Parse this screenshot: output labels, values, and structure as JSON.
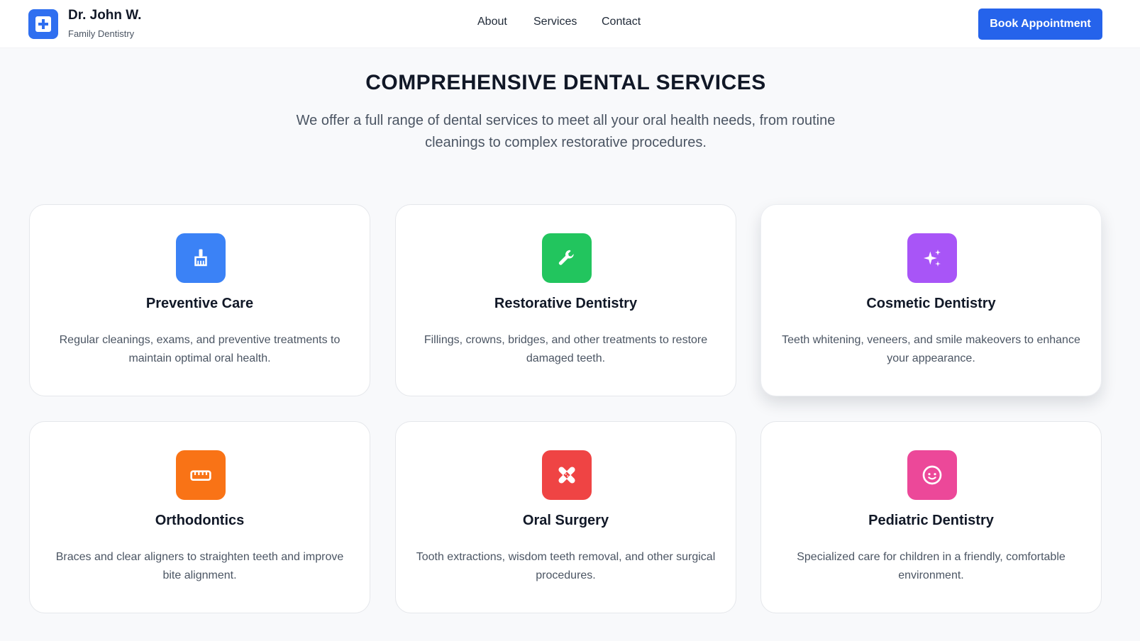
{
  "header": {
    "brand_name": "Dr. John W.",
    "brand_subtitle": "Family Dentistry",
    "logo_icon": "medical-cross-icon",
    "nav": [
      "About",
      "Services",
      "Contact"
    ],
    "cta_label": "Book Appointment"
  },
  "colors": {
    "primary": "#2563eb",
    "logo_bg": "#2f6ff0",
    "blue": "#3b82f6",
    "green": "#22c55e",
    "purple": "#a855f7",
    "orange": "#f97316",
    "red": "#ef4444",
    "pink": "#ec4899"
  },
  "section": {
    "title": "COMPREHENSIVE DENTAL SERVICES",
    "subtitle": "We offer a full range of dental services to meet all your oral health needs, from routine cleanings to complex restorative procedures."
  },
  "services": [
    {
      "title": "Preventive Care",
      "description": "Regular cleanings, exams, and preventive treatments to maintain optimal oral health.",
      "icon": "brush-icon",
      "color": "#3b82f6"
    },
    {
      "title": "Restorative Dentistry",
      "description": "Fillings, crowns, bridges, and other treatments to restore damaged teeth.",
      "icon": "wrench-icon",
      "color": "#22c55e"
    },
    {
      "title": "Cosmetic Dentistry",
      "description": "Teeth whitening, veneers, and smile makeovers to enhance your appearance.",
      "icon": "sparkles-icon",
      "color": "#a855f7"
    },
    {
      "title": "Orthodontics",
      "description": "Braces and clear aligners to straighten teeth and improve bite alignment.",
      "icon": "ruler-icon",
      "color": "#f97316"
    },
    {
      "title": "Oral Surgery",
      "description": "Tooth extractions, wisdom teeth removal, and other surgical procedures.",
      "icon": "bandage-icon",
      "color": "#ef4444"
    },
    {
      "title": "Pediatric Dentistry",
      "description": "Specialized care for children in a friendly, comfortable environment.",
      "icon": "child-face-icon",
      "color": "#ec4899"
    }
  ]
}
